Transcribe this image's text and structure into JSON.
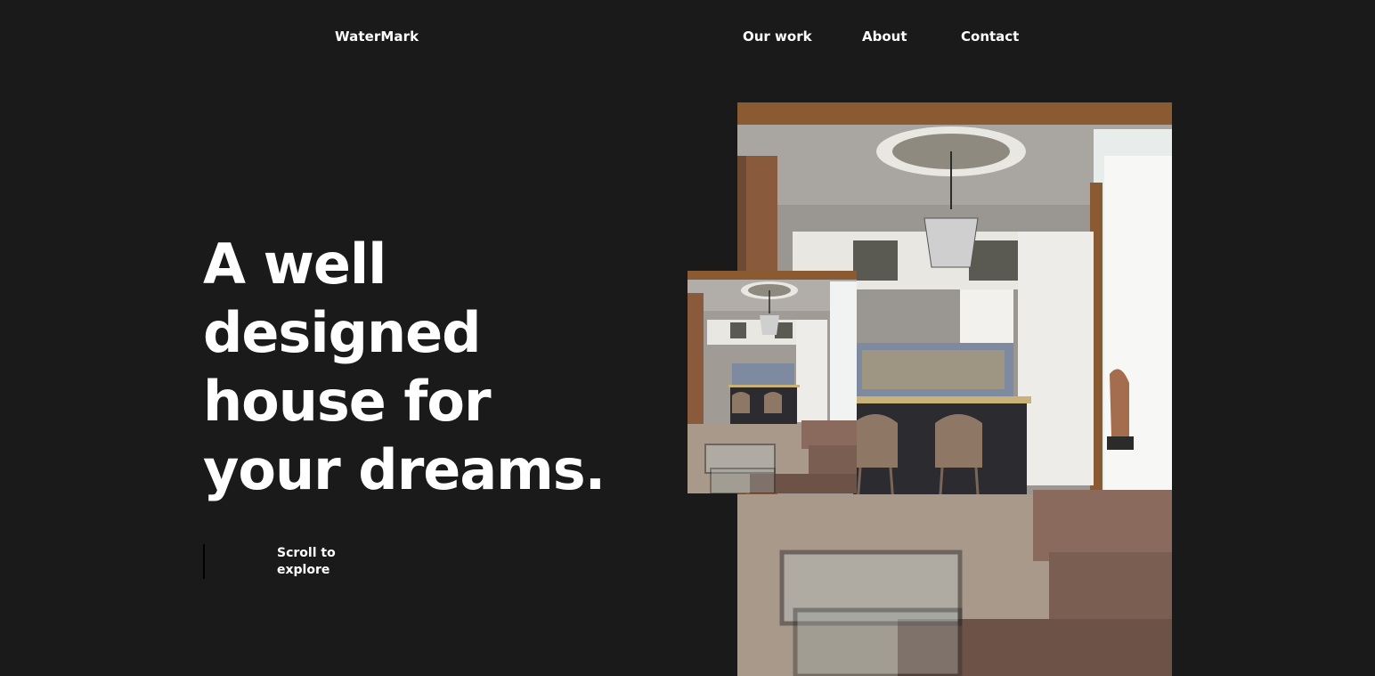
{
  "brand": {
    "name": "WaterMark"
  },
  "nav": {
    "items": [
      {
        "label": "Our work"
      },
      {
        "label": "About"
      },
      {
        "label": "Contact"
      }
    ]
  },
  "hero": {
    "title_lines": [
      "A well",
      "designed",
      "house for",
      "your dreams."
    ],
    "scroll_lines": [
      "Scroll to",
      "explore"
    ]
  },
  "images": {
    "main": "interior-kitchen-photo",
    "secondary": "interior-kitchen-photo-small"
  },
  "colors": {
    "background": "#1a1a1b",
    "text": "#ffffff",
    "wood": "#8a5a32",
    "sofa": "#8a6a5c",
    "cabinet": "#e9e7e2",
    "floor": "#a8998a"
  }
}
